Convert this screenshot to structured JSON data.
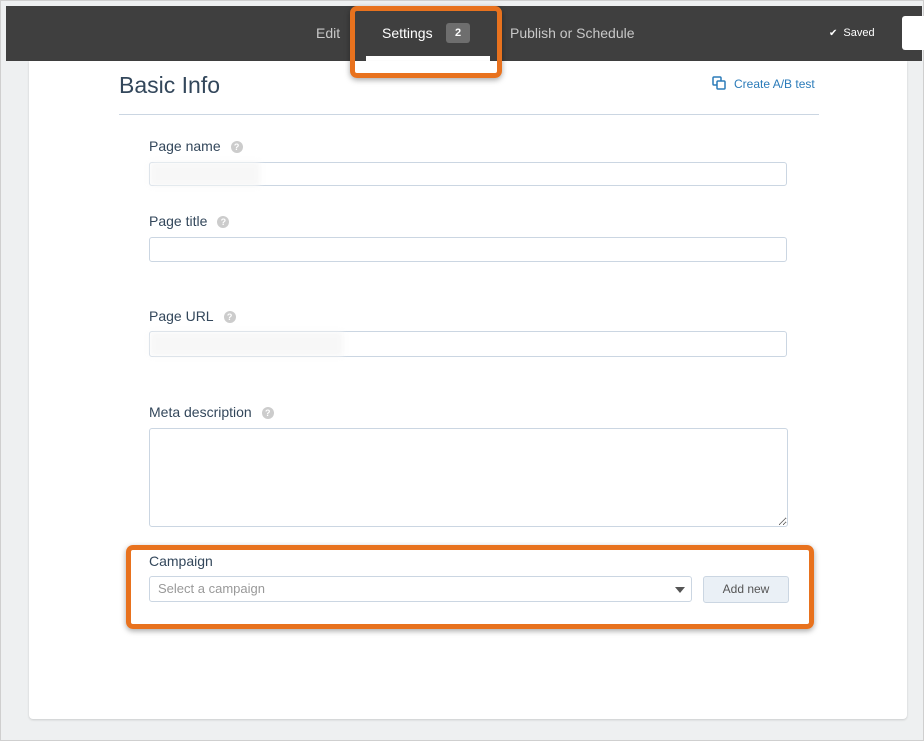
{
  "topbar": {
    "tabs": {
      "edit": "Edit",
      "settings": "Settings",
      "settings_badge": "2",
      "publish": "Publish or Schedule"
    },
    "saved_label": "Saved"
  },
  "basic_info": {
    "title": "Basic Info",
    "ab_test_link": "Create A/B test"
  },
  "fields": {
    "page_name": {
      "label": "Page name",
      "value": ""
    },
    "page_title": {
      "label": "Page title",
      "value": ""
    },
    "page_url": {
      "label": "Page URL",
      "value": ""
    },
    "meta_description": {
      "label": "Meta description",
      "value": ""
    },
    "campaign": {
      "label": "Campaign",
      "placeholder": "Select a campaign",
      "add_new": "Add new"
    }
  },
  "colors": {
    "topbar": "#3f3f3f",
    "highlight": "#e8721e",
    "link": "#2b7bb9",
    "heading": "#33475b"
  },
  "icons": {
    "saved": "check-icon",
    "ab_test": "ab-test-icon",
    "help": "help-icon",
    "dropdown": "caret-down-icon"
  }
}
